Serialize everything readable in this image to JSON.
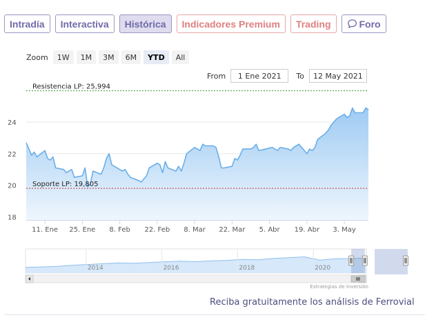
{
  "tabs": [
    {
      "label": "Intradía",
      "name": "tab-intradia",
      "style": "normal"
    },
    {
      "label": "Interactiva",
      "name": "tab-interactiva",
      "style": "normal"
    },
    {
      "label": "Histórica",
      "name": "tab-historica",
      "style": "active"
    },
    {
      "label": "Indicadores Premium",
      "name": "tab-indicadores-premium",
      "style": "premium"
    },
    {
      "label": "Trading",
      "name": "tab-trading",
      "style": "premium"
    },
    {
      "label": "Foro",
      "name": "tab-foro",
      "style": "normal",
      "icon": "chat-bubble-icon"
    }
  ],
  "zoom": {
    "label": "Zoom",
    "options": [
      "1W",
      "1M",
      "3M",
      "6M",
      "YTD",
      "All"
    ],
    "selected": "YTD"
  },
  "range": {
    "from_label": "From",
    "from": "1 Ene 2021",
    "to_label": "To",
    "to": "12 May 2021"
  },
  "chart_data": {
    "type": "area",
    "y_ticks": [
      18,
      20,
      22,
      24
    ],
    "ylim": [
      17.8,
      26.5
    ],
    "x_ticks": [
      "11. Ene",
      "25. Ene",
      "8. Feb",
      "22. Feb",
      "8. Mar",
      "22. Mar",
      "5. Abr",
      "19. Abr",
      "3. May"
    ],
    "x_tick_dates": [
      "2021-01-11",
      "2021-01-25",
      "2021-02-08",
      "2021-02-22",
      "2021-03-08",
      "2021-03-22",
      "2021-04-05",
      "2021-04-19",
      "2021-05-03"
    ],
    "xlim": [
      "2021-01-04",
      "2021-05-12"
    ],
    "series": [
      {
        "x": [
          "2021-01-04",
          "2021-01-05",
          "2021-01-06",
          "2021-01-07",
          "2021-01-08",
          "2021-01-11",
          "2021-01-12",
          "2021-01-13",
          "2021-01-14",
          "2021-01-15",
          "2021-01-18",
          "2021-01-19",
          "2021-01-20",
          "2021-01-21",
          "2021-01-22",
          "2021-01-25",
          "2021-01-26",
          "2021-01-27",
          "2021-01-28",
          "2021-01-29",
          "2021-02-01",
          "2021-02-02",
          "2021-02-03",
          "2021-02-04",
          "2021-02-05",
          "2021-02-08",
          "2021-02-09",
          "2021-02-10",
          "2021-02-11",
          "2021-02-12",
          "2021-02-15",
          "2021-02-16",
          "2021-02-17",
          "2021-02-18",
          "2021-02-19",
          "2021-02-22",
          "2021-02-23",
          "2021-02-24",
          "2021-02-25",
          "2021-02-26",
          "2021-03-01",
          "2021-03-02",
          "2021-03-03",
          "2021-03-04",
          "2021-03-05",
          "2021-03-08",
          "2021-03-09",
          "2021-03-10",
          "2021-03-11",
          "2021-03-12",
          "2021-03-15",
          "2021-03-16",
          "2021-03-17",
          "2021-03-18",
          "2021-03-19",
          "2021-03-22",
          "2021-03-23",
          "2021-03-24",
          "2021-03-25",
          "2021-03-26",
          "2021-03-29",
          "2021-03-30",
          "2021-03-31",
          "2021-04-01",
          "2021-04-06",
          "2021-04-07",
          "2021-04-08",
          "2021-04-09",
          "2021-04-12",
          "2021-04-13",
          "2021-04-14",
          "2021-04-15",
          "2021-04-16",
          "2021-04-19",
          "2021-04-20",
          "2021-04-21",
          "2021-04-22",
          "2021-04-23",
          "2021-04-26",
          "2021-04-27",
          "2021-04-28",
          "2021-04-29",
          "2021-04-30",
          "2021-05-03",
          "2021-05-04",
          "2021-05-05",
          "2021-05-06",
          "2021-05-07",
          "2021-05-10",
          "2021-05-11",
          "2021-05-12"
        ],
        "values": [
          22.7,
          22.3,
          21.9,
          22.1,
          21.8,
          22.2,
          21.7,
          21.6,
          21.8,
          21.1,
          21.0,
          20.8,
          20.9,
          21.0,
          20.5,
          20.6,
          21.1,
          19.9,
          20.1,
          20.9,
          20.7,
          21.1,
          21.7,
          22.0,
          21.3,
          21.0,
          20.9,
          21.0,
          20.7,
          20.5,
          20.3,
          20.2,
          20.4,
          20.6,
          21.1,
          21.4,
          21.3,
          20.8,
          21.5,
          21.1,
          20.9,
          21.2,
          20.9,
          21.4,
          22.0,
          22.4,
          22.3,
          22.2,
          22.6,
          22.5,
          22.5,
          22.4,
          21.8,
          21.1,
          21.1,
          21.2,
          21.7,
          21.6,
          21.9,
          22.3,
          22.3,
          22.4,
          22.6,
          22.2,
          22.4,
          22.3,
          22.2,
          22.4,
          22.3,
          22.2,
          22.4,
          22.5,
          22.6,
          22.0,
          22.3,
          22.2,
          22.4,
          22.9,
          23.3,
          23.5,
          23.8,
          24.0,
          24.2,
          24.5,
          24.3,
          24.4,
          24.9,
          24.6,
          24.6,
          24.9,
          24.8
        ]
      }
    ],
    "annotations": [
      {
        "label": "Resistencia LP: 25,994",
        "value": 25.994,
        "color": "#2e9d2e"
      },
      {
        "label": "Soporte LP: 19,805",
        "value": 19.805,
        "color": "#c83030"
      }
    ],
    "grid": true,
    "colors": {
      "line": "#6aaee8",
      "fill_top": "#9fcbf3",
      "fill_bottom": "#eef6fd"
    }
  },
  "navigator": {
    "labels": [
      "2014",
      "2016",
      "2018",
      "2020"
    ],
    "label_years": [
      2014,
      2016,
      2018,
      2020
    ],
    "range_years": [
      2012.4,
      2021.4
    ],
    "selected_years": [
      2021.0,
      2021.36
    ],
    "values": [
      9.5,
      10.2,
      11.0,
      12.8,
      14.2,
      15.5,
      16.8,
      16.2,
      17.5,
      18.8,
      19.6,
      18.9,
      20.2,
      21.0,
      22.5,
      22.0,
      24.2,
      25.4,
      26.8,
      21.5,
      23.8,
      24.0,
      24.9
    ]
  },
  "credit": "Estrategias de Inversión",
  "cta": "Reciba gratuitamente los análisis de Ferrovial"
}
